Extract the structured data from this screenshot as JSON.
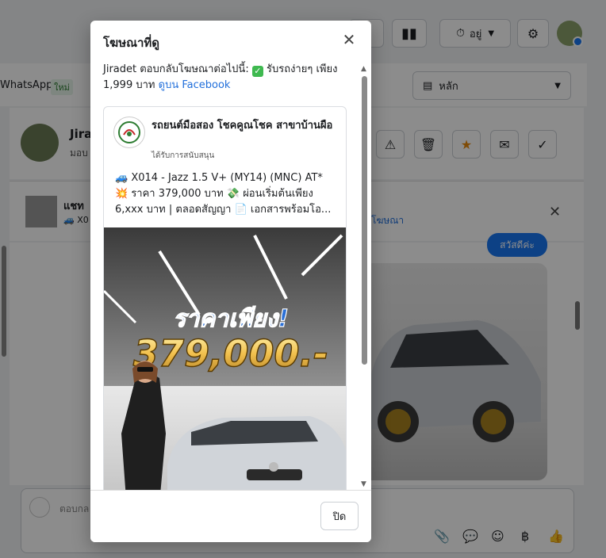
{
  "background": {
    "header": {
      "status_label": "อยู่"
    },
    "inbox": {
      "tab_label": "WhatsApp",
      "new_badge": "ใหม่"
    },
    "folder_select": {
      "label": "หลัก"
    },
    "conversation": {
      "name_partial": "Jira",
      "sub_partial": "มอบ"
    },
    "ad_reply_bar": {
      "title_partial": "แชท",
      "snippet_partial": "🚙 X0",
      "view_ad_partial": "โฆษณา"
    },
    "message_bubble": {
      "text": "สวัสดีค่ะ"
    },
    "composer": {
      "placeholder_partial": "ตอบกล"
    }
  },
  "modal": {
    "title": "โฆษณาที่ดู",
    "intro_prefix": "Jiradet ตอบกลับโฆษณาต่อไปนี้:",
    "intro_text": "รับรถง่ายๆ เพียง 1,999 บาท",
    "intro_link": "ดูบน Facebook",
    "ad": {
      "page_name": "รถยนต์มือสอง โชคคูณโชค สาขาบ้านผือ",
      "sponsored_label": "ได้รับการสนับสนุน",
      "line1": "🚙 X014 - Jazz 1.5 V+ (MY14) (MNC) AT*",
      "line2": "💥 ราคา 379,000 บาท 💸 ผ่อนเริ่มต้นเพียง",
      "line3": "6,xxx บาท | ตลอดสัญญา 📄 เอกสารพร้อมโอ...",
      "image_headline": "ราคาเพียง!",
      "image_price": "379,000.-"
    },
    "close_button": "ปิด"
  },
  "colors": {
    "accent": "#216fdb",
    "overlay": "rgba(0,0,0,0.45)",
    "price_gold": "#f2c14e",
    "headline_blue": "#2a6fd6"
  }
}
